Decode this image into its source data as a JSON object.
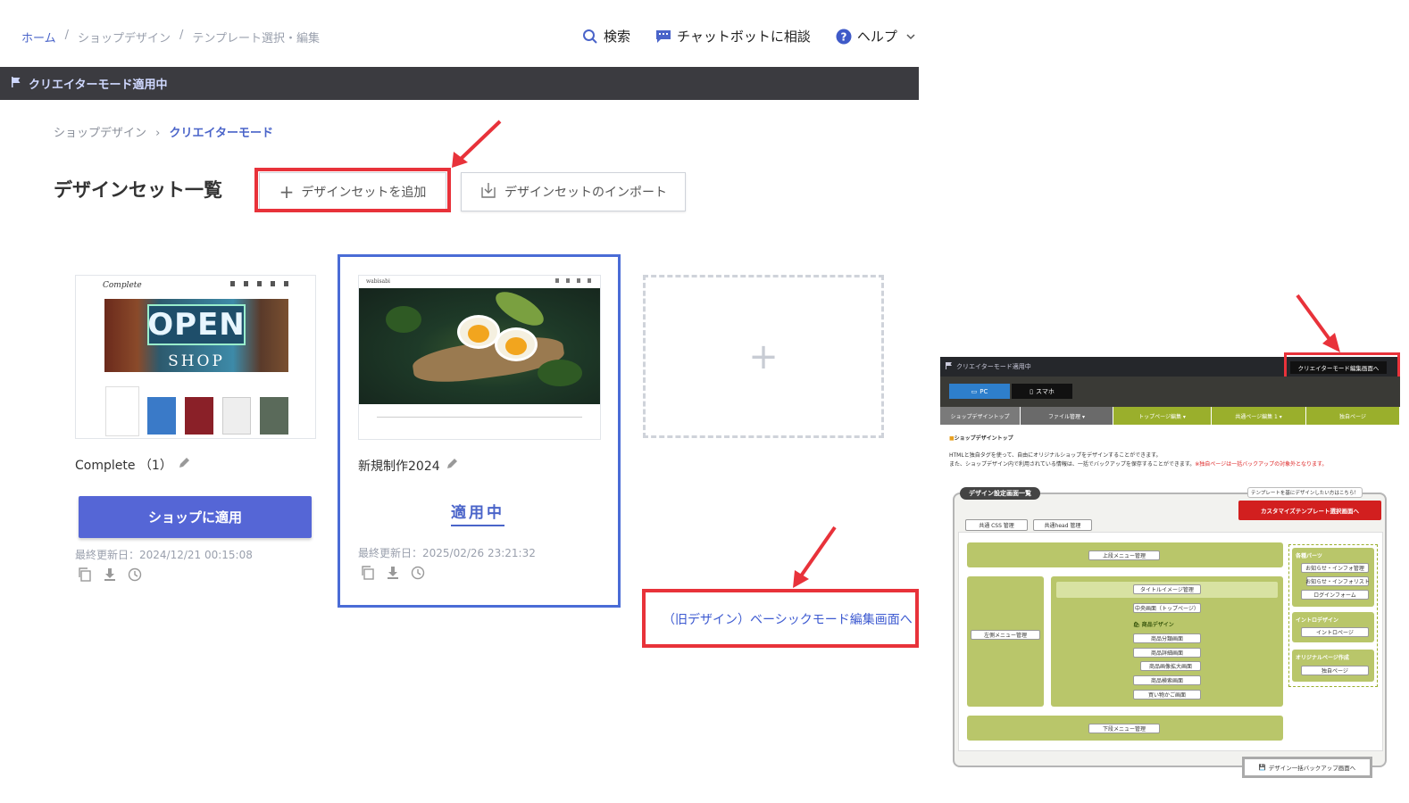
{
  "breadcrumb": {
    "home": "ホーム",
    "sep": "/",
    "shop_design": "ショップデザイン",
    "template": "テンプレート選択・編集"
  },
  "topnav": {
    "search": "検索",
    "chatbot": "チャットボットに相談",
    "help": "ヘルプ"
  },
  "mode_bar": {
    "label": "クリエイターモード適用中"
  },
  "subcrumb": {
    "parent": "ショップデザイン",
    "sep": "›",
    "current": "クリエイターモード"
  },
  "page_title": "デザインセット一覧",
  "buttons": {
    "add_design_set": "デザインセットを追加",
    "import_design_set": "デザインセットのインポート"
  },
  "cards": [
    {
      "name": "Complete （1）",
      "apply_label": "ショップに適用",
      "updated": "最終更新日：2024/12/21 00:15:08",
      "thumb": {
        "logo": "Complete",
        "sign_top": "OPEN",
        "sign_bottom": "SHOP"
      }
    },
    {
      "name": "新規制作2024",
      "status": "適用中",
      "updated": "最終更新日：2025/02/26 23:21:32",
      "thumb": {
        "logo": "wabisabi"
      }
    }
  ],
  "add_card_symbol": "+",
  "old_design_link": "（旧デザイン）ベーシックモード編集画面へ",
  "colors": {
    "accent": "#5566d6",
    "annotation_red": "#e8323a",
    "dark_bar": "#3b3b40",
    "selected_border": "#4a6cd6",
    "inset_green": "#b9c66a"
  },
  "inset": {
    "mode_label": "クリエイターモード適用中",
    "editor_button": "クリエイターモード編集画面へ",
    "device_tabs": [
      "PC",
      "スマホ"
    ],
    "nav": [
      "ショップデザイントップ",
      "ファイル管理 ▾",
      "トップページ編集 ▾",
      "共通ページ編集 1 ▾",
      "独自ページ"
    ],
    "section_title": "ショップデザイントップ",
    "desc1": "HTMLと独自タグを使って、自由にオリジナルショップをデザインすることができます。",
    "desc2": "また、ショップデザイン内で利用されている情報は、一括でバックアップを保存することができます。",
    "desc_note": "※独自ページは一括バックアップの対象外となります。",
    "panel_title": "デザイン設定画面一覧",
    "template_hint": "テンプレートを基にデザインしたい方はこちら！",
    "customize_button": "カスタマイズテンプレート選択画面へ",
    "tabs": [
      "共通 CSS 管理",
      "共通head 管理"
    ],
    "top_menu": "上段メニュー管理",
    "left_menu": "左側メニュー管理",
    "title_image": "タイトルイメージ管理",
    "center": "中央画面（トップページ）",
    "product_design": "商品デザイン",
    "product_items": [
      "商品分類画面",
      "商品詳細画面",
      "商品画像拡大画面",
      "商品検索画面",
      "買い物かご画面"
    ],
    "bottom_menu": "下段メニュー管理",
    "parts_title": "各種パーツ",
    "parts": [
      "お知らせ・インフォ管理",
      "お知らせ・インフォリスト",
      "ログインフォーム"
    ],
    "intro_title": "イントロデザイン",
    "intro_item": "イントロページ",
    "original_title": "オリジナルページ作成",
    "original_item": "独自ページ",
    "backup_button": "デザイン一括バックアップ画面へ"
  }
}
